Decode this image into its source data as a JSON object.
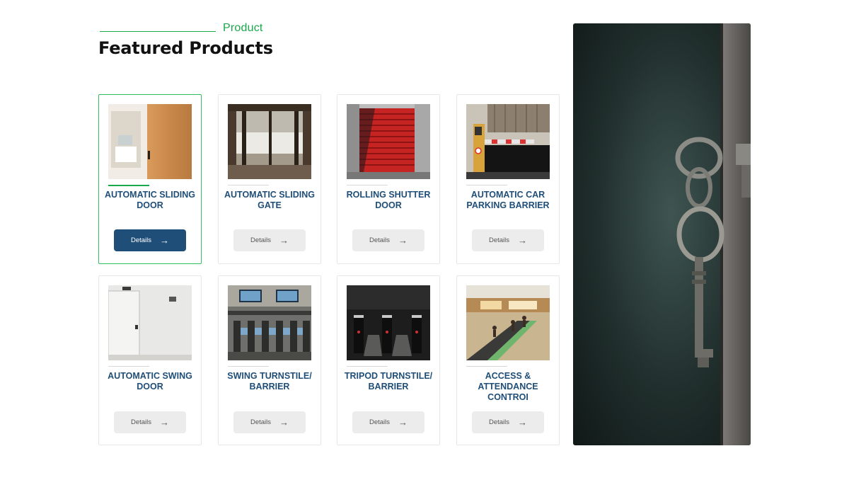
{
  "section": {
    "eyebrow": "Product",
    "title": "Featured Products"
  },
  "button_label": "Details",
  "arrow_icon": "→",
  "products": [
    {
      "title": "AUTOMATIC SLIDING DOOR",
      "image": "sliding-door-photo",
      "selected": true
    },
    {
      "title": "AUTOMATIC SLIDING GATE",
      "image": "sliding-gate-photo",
      "selected": false
    },
    {
      "title": "ROLLING SHUTTER DOOR",
      "image": "rolling-shutter-photo",
      "selected": false
    },
    {
      "title": "AUTOMATIC CAR PARKING BARRIER",
      "image": "parking-barrier-photo",
      "selected": false
    },
    {
      "title": "AUTOMATIC SWING DOOR",
      "image": "swing-door-photo",
      "selected": false
    },
    {
      "title": "SWING TURNSTILE/ BARRIER",
      "image": "swing-turnstile-photo",
      "selected": false
    },
    {
      "title": "TRIPOD TURNSTILE/ BARRIER",
      "image": "tripod-turnstile-photo",
      "selected": false
    },
    {
      "title": "ACCESS & ATTENDANCE CONTROI",
      "image": "escalator-mall-photo",
      "selected": false
    }
  ],
  "hero_image": "keys-in-door-photo",
  "colors": {
    "accent_green": "#18a94a",
    "title_blue": "#1f4e78",
    "button_grey": "#ececec"
  }
}
